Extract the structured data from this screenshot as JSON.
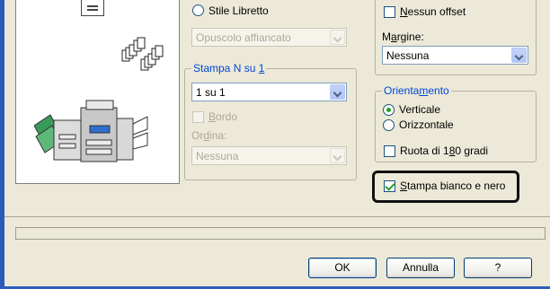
{
  "left_panel": {
    "booklet_style_radio": {
      "label": "Stile Libretto",
      "checked": false
    },
    "booklet_select": {
      "value": "Opuscolo affiancato",
      "enabled": false
    }
  },
  "n_up_group": {
    "title": "Stampa N su 1",
    "title_accel": "1",
    "select": {
      "value": "1 su 1"
    },
    "border_check": {
      "label": "Bordo",
      "checked": false,
      "enabled": false
    },
    "order_label": "Ordina:",
    "order_select": {
      "value": "Nessuna",
      "enabled": false
    }
  },
  "right_panel": {
    "no_offset_check": {
      "label": "Nessun offset",
      "checked": false
    },
    "margin_label": "Margine:",
    "margin_select": {
      "value": "Nessuna"
    }
  },
  "orientation_group": {
    "title": "Orientamento",
    "portrait_radio": {
      "label": "Verticale",
      "checked": true
    },
    "landscape_radio": {
      "label": "Orizzontale",
      "checked": false
    },
    "rotate_check": {
      "label": "Ruota di 180 gradi",
      "checked": false
    }
  },
  "bw_print_check": {
    "label": "Stampa bianco e nero",
    "checked": true
  },
  "buttons": {
    "ok": "OK",
    "cancel": "Annulla",
    "help": "?"
  },
  "colors": {
    "accent_blue": "#0046d5",
    "check_green": "#21a121",
    "window_frame": "#2b5cb8",
    "dialog_bg": "#ece9d8"
  }
}
